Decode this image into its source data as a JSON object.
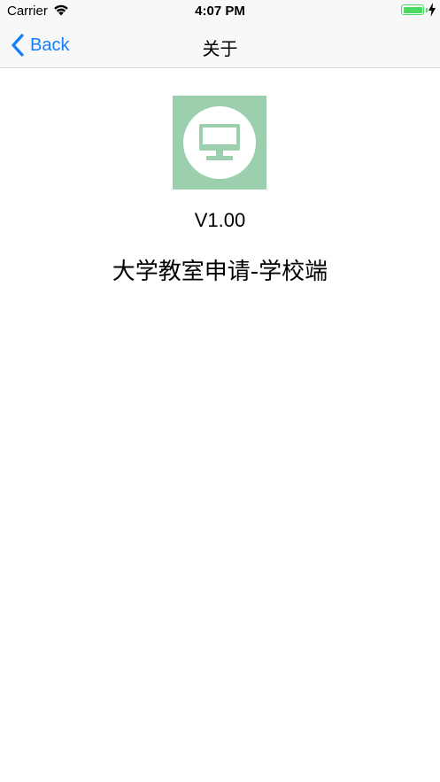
{
  "status_bar": {
    "carrier": "Carrier",
    "time": "4:07 PM",
    "wifi_icon": "wifi-icon",
    "battery_icon": "battery-full-icon",
    "charging_icon": "charging-bolt-icon",
    "battery_color": "#4cd964"
  },
  "nav": {
    "back_label": "Back",
    "back_icon": "chevron-left-icon",
    "title": "关于",
    "accent_color": "#147efb"
  },
  "content": {
    "app_icon": "monitor-icon",
    "app_icon_bg": "#9ccfae",
    "version": "V1.00",
    "app_name": "大学教室申请-学校端"
  }
}
